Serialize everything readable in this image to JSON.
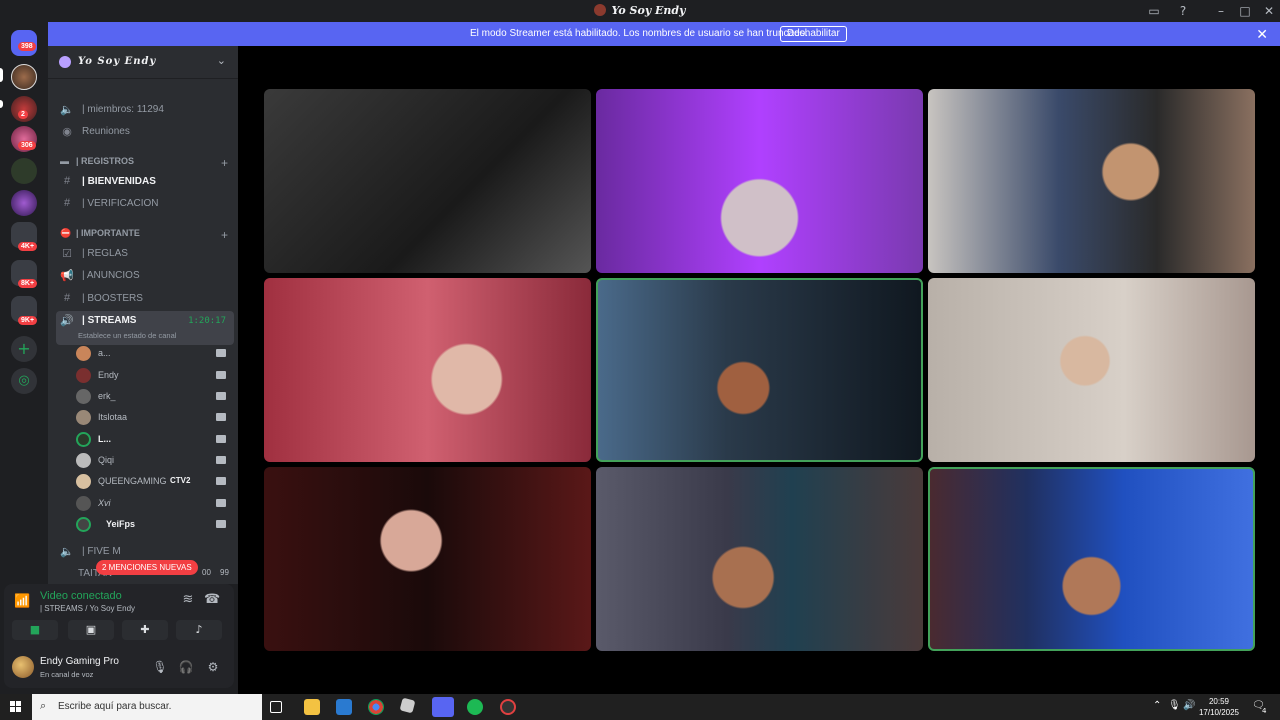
{
  "window": {
    "title": "Yo Soy Endy"
  },
  "banner": {
    "message": "El modo Streamer está habilitado. Los nombres de usuario se han truncado.",
    "button": "Deshabilitar"
  },
  "guilds": {
    "badges": [
      "398",
      "2",
      "306",
      "4K+",
      "8K+",
      "9K+"
    ]
  },
  "server": {
    "name": "Yo Soy Endy"
  },
  "channels": {
    "members": "| miembros: 11294",
    "reuniones": "Reuniones",
    "cat_registros": "| REGISTROS",
    "bienvenidas": "| BIENVENIDAS",
    "verificacion": "| VERIFICACION",
    "cat_importante": "| IMPORTANTE",
    "reglas": "| REGLAS",
    "anuncios": "| ANUNCIOS",
    "boosters": "| BOOSTERS",
    "streams": "| STREAMS",
    "streams_timer": "1:20:17",
    "streams_status": "Establece un estado de canal",
    "fivem": "| FIVE M",
    "taitan": "TAITAN",
    "taitan_count_a": "00",
    "taitan_count_b": "99"
  },
  "voice_users": [
    {
      "name": "a..."
    },
    {
      "name": "Endy"
    },
    {
      "name": "erk_"
    },
    {
      "name": "Itslotaa"
    },
    {
      "name": "L..."
    },
    {
      "name": "Qiqi"
    },
    {
      "name": "QUEENGAMING",
      "tag": "CTV2"
    },
    {
      "name": "Xvi"
    },
    {
      "name": "YeiFps"
    }
  ],
  "mentions": "2 MENCIONES NUEVAS",
  "voice_panel": {
    "status": "Video conectado",
    "channel": "| STREAMS / Yo Soy Endy"
  },
  "user_panel": {
    "name": "Endy Gaming Pro",
    "status": "En canal de voz"
  },
  "taskbar": {
    "search_placeholder": "Escribe aquí para buscar.",
    "time": "20:59",
    "date": "17/10/2025",
    "notifications": "4"
  }
}
